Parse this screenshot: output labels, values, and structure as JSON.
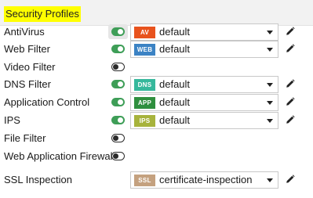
{
  "section": {
    "title": "Security Profiles"
  },
  "rows": [
    {
      "label": "AntiVirus",
      "enabled": true,
      "badge": "AV",
      "badge_color": "#e8531e",
      "value": "default"
    },
    {
      "label": "Web Filter",
      "enabled": true,
      "badge": "WEB",
      "badge_color": "#3c83c4",
      "value": "default"
    },
    {
      "label": "Video Filter",
      "enabled": false
    },
    {
      "label": "DNS Filter",
      "enabled": true,
      "badge": "DNS",
      "badge_color": "#36b89c",
      "value": "default"
    },
    {
      "label": "Application Control",
      "enabled": true,
      "badge": "APP",
      "badge_color": "#2f8f3e",
      "value": "default"
    },
    {
      "label": "IPS",
      "enabled": true,
      "badge": "IPS",
      "badge_color": "#a7b33c",
      "value": "default"
    },
    {
      "label": "File Filter",
      "enabled": false
    },
    {
      "label": "Web Application Firewall",
      "enabled": false
    },
    {
      "label": "SSL Inspection",
      "badge": "SSL",
      "badge_color": "#c4a17f",
      "value": "certificate-inspection"
    }
  ],
  "colors": {
    "toggle_on": "#3e9e57",
    "highlight": "#ffff00"
  },
  "icons": {
    "toggle": "toggle-switch-icon",
    "edit": "pencil-icon",
    "dropdown": "caret-down-icon"
  }
}
